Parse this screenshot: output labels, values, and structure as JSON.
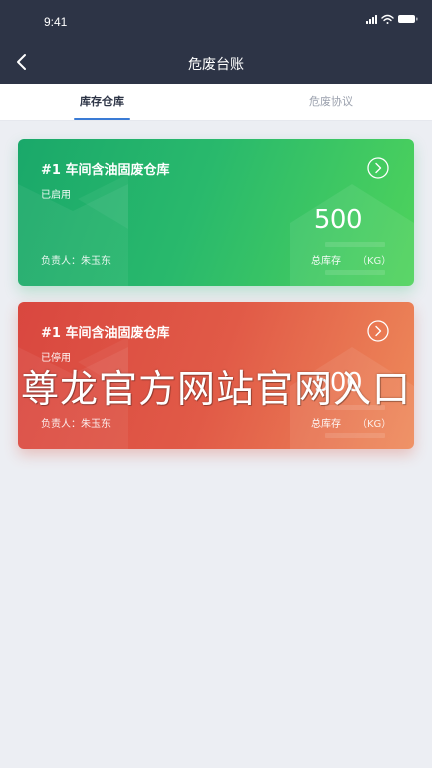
{
  "status_bar": {
    "time": "9:41"
  },
  "nav": {
    "title": "危废台账"
  },
  "tabs": [
    {
      "label": "库存仓库"
    },
    {
      "label": "危废协议"
    }
  ],
  "cards": [
    {
      "title": "#1 车间含油固废仓库",
      "status": "已启用",
      "manager": "负责人：朱玉东",
      "value": "500",
      "total_label": "总库存",
      "unit": "（KG）",
      "color": "#29b96c"
    },
    {
      "title": "#1 车间含油固废仓库",
      "status": "已停用",
      "manager": "负责人：朱玉东",
      "value": "500",
      "total_label": "总库存",
      "unit": "（KG）",
      "color": "#e15a47"
    }
  ],
  "watermark": "尊龙官方网站官网入口"
}
